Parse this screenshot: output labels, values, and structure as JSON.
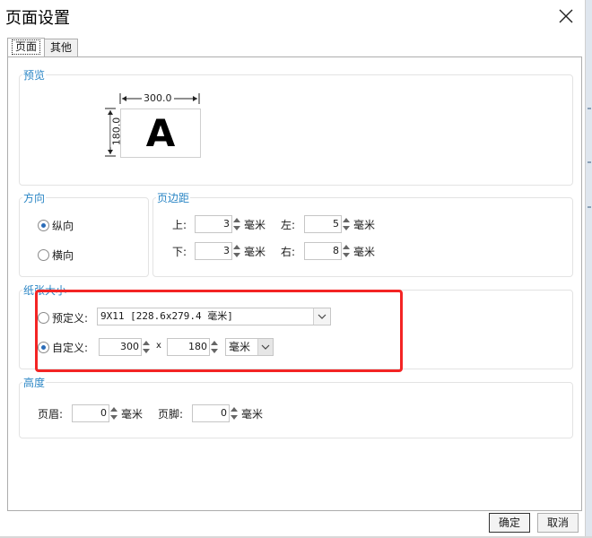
{
  "window": {
    "title": "页面设置"
  },
  "tabs": [
    {
      "label": "页面"
    },
    {
      "label": "其他"
    }
  ],
  "preview": {
    "group_title": "预览",
    "width_label": "300.0",
    "height_label": "180.0",
    "sample_letter": "A"
  },
  "orientation": {
    "group_title": "方向",
    "portrait_label": "纵向",
    "landscape_label": "横向",
    "selected": "portrait"
  },
  "margins": {
    "group_title": "页边距",
    "top_label": "上:",
    "top_value": "3",
    "left_label": "左:",
    "left_value": "5",
    "bottom_label": "下:",
    "bottom_value": "3",
    "right_label": "右:",
    "right_value": "8",
    "unit": "毫米"
  },
  "paper_size": {
    "group_title": "纸张大小",
    "predefined_label": "预定义:",
    "predefined_value": "9X11 [228.6x279.4 毫米]",
    "custom_label": "自定义:",
    "custom_width": "300",
    "times": "x",
    "custom_height": "180",
    "unit_value": "毫米",
    "selected": "custom"
  },
  "height": {
    "group_title": "高度",
    "header_label": "页眉:",
    "header_value": "0",
    "footer_label": "页脚:",
    "footer_value": "0",
    "unit": "毫米"
  },
  "buttons": {
    "ok": "确定",
    "cancel": "取消"
  },
  "colors": {
    "group_title": "#2b86c5",
    "highlight": "#f32424",
    "radio_dot": "#2b6cb8"
  },
  "icons": {
    "close": "close-icon",
    "dropdown": "chevron-down-icon",
    "spin_up": "caret-up-icon",
    "spin_down": "caret-down-icon"
  }
}
